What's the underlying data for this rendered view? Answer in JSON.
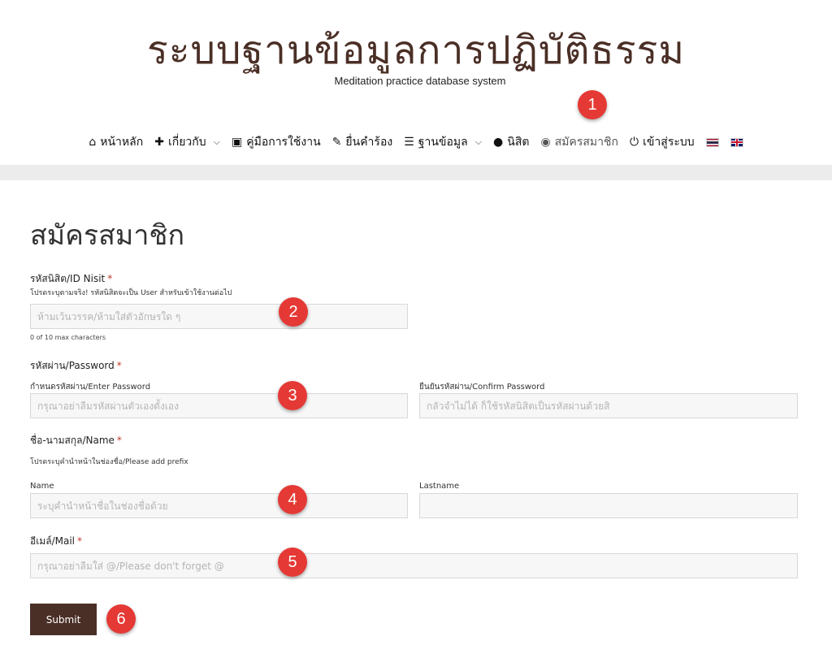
{
  "site": {
    "title": "ระบบฐานข้อมูลการปฏิบัติธรรม",
    "subtitle": "Meditation practice database system"
  },
  "nav": {
    "items": [
      {
        "label": "หน้าหลัก",
        "icon": "home-icon",
        "glyph": "⌂"
      },
      {
        "label": "เกี่ยวกับ",
        "icon": "pin-icon",
        "glyph": "✚",
        "dropdown": true
      },
      {
        "label": "คู่มือการใช้งาน",
        "icon": "contact-book-icon",
        "glyph": "▣"
      },
      {
        "label": "ยื่นคำร้อง",
        "icon": "edit-icon",
        "glyph": "✎"
      },
      {
        "label": "ฐานข้อมูล",
        "icon": "list-icon",
        "glyph": "☰",
        "dropdown": true
      },
      {
        "label": "นิสิต",
        "icon": "user-icon",
        "glyph": "●"
      },
      {
        "label": "สมัครสมาชิก",
        "icon": "podcast-icon",
        "glyph": "◉"
      },
      {
        "label": "เข้าสู่ระบบ",
        "icon": "power-icon",
        "glyph": "⏻"
      }
    ],
    "flags": [
      "thai-flag-icon",
      "uk-flag-icon"
    ]
  },
  "form": {
    "heading": "สมัครสมาชิก",
    "id_nisit": {
      "label": "รหัสนิสิต/ID Nisit",
      "required_mark": "*",
      "description": "โปรดระบุตามจริง! รหัสนิสิตจะเป็น User สำหรับเข้าใช้งานต่อไป",
      "placeholder": "ห้ามเว้นวรรค/ห้ามใส่ตัวอักษรใด ๆ",
      "value": "",
      "counter": "0 of 10 max characters"
    },
    "password": {
      "label": "รหัสผ่าน/Password",
      "required_mark": "*",
      "enter_label": "กำหนดรหัสผ่าน/Enter Password",
      "enter_placeholder": "กรุณาอย่าลืมรหัสผ่านตัวเองตั้งเอง",
      "confirm_label": "ยืนยันรหัสผ่าน/Confirm Password",
      "confirm_placeholder": "กลัวจำไม่ได้ ก็ใช้รหัสนิสิตเป็นรหัสผ่านด้วยสิ"
    },
    "name": {
      "label": "ชื่อ-นามสกุล/Name",
      "required_mark": "*",
      "description": "โปรดระบุคำนำหน้าในช่องชื่อ/Please add prefix",
      "first_label": "Name",
      "first_placeholder": "ระบุคำนำหน้าชื่อในช่องชื่อด้วย",
      "last_label": "Lastname",
      "last_placeholder": ""
    },
    "email": {
      "label": "อีเมล์/Mail",
      "required_mark": "*",
      "placeholder": "กรุณาอย่าลืมใส่ @/Please don't forget @"
    },
    "submit_label": "Submit"
  },
  "markers": [
    "1",
    "2",
    "3",
    "4",
    "5",
    "6"
  ],
  "colors": {
    "brand": "#4a2f26",
    "marker": "#e53935",
    "required": "#c0392b",
    "band": "#ececec",
    "field_bg": "#f7f7f7"
  }
}
